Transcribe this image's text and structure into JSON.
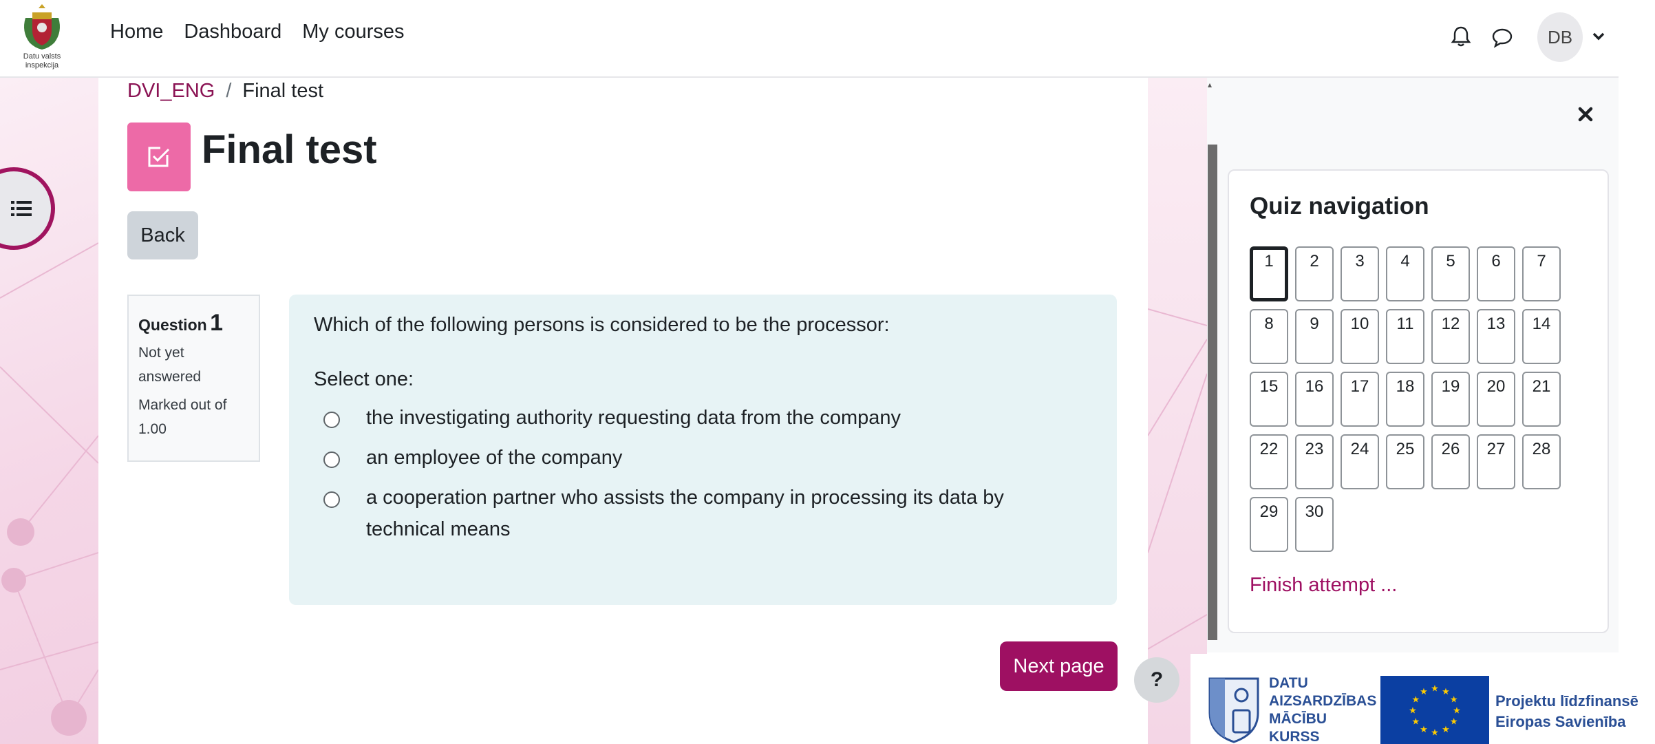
{
  "navbar": {
    "logo_lines": [
      "Datu valsts",
      "inspekcija"
    ],
    "links": [
      "Home",
      "Dashboard",
      "My courses"
    ],
    "user_initials": "DB",
    "icons": {
      "notifications": "bell-icon",
      "messages": "chat-icon",
      "user_menu": "chevron-down-icon"
    }
  },
  "breadcrumb": {
    "course": "DVI_ENG",
    "separator": "/",
    "current": "Final test"
  },
  "page": {
    "title": "Final test",
    "back_label": "Back"
  },
  "question": {
    "label": "Question",
    "number": "1",
    "state": "Not yet answered",
    "grade": "Marked out of 1.00",
    "text": "Which of the following persons is considered to be the processor:",
    "prompt": "Select one:",
    "answers": [
      "the investigating authority requesting data from the company",
      "an employee of the company",
      "a cooperation partner who assists the company in processing its data by technical means"
    ],
    "selected": null
  },
  "actions": {
    "next_label": "Next page",
    "help_label": "?"
  },
  "quiz_navigation": {
    "title": "Quiz navigation",
    "current": 1,
    "questions": [
      "1",
      "2",
      "3",
      "4",
      "5",
      "6",
      "7",
      "8",
      "9",
      "10",
      "11",
      "12",
      "13",
      "14",
      "15",
      "16",
      "17",
      "18",
      "19",
      "20",
      "21",
      "22",
      "23",
      "24",
      "25",
      "26",
      "27",
      "28",
      "29",
      "30"
    ],
    "finish_label": "Finish attempt ..."
  },
  "footer": {
    "course_logo_lines": [
      "DATU",
      "AIZSARDZĪBAS",
      "MĀCĪBU",
      "KURSS"
    ],
    "eu_lines": [
      "Projektu līdzfinansē",
      "Eiropas Savienība"
    ]
  },
  "colors": {
    "accent": "#9e1062",
    "quiz_badge": "#ed6aa7",
    "question_bg": "#e7f3f5",
    "eu_blue": "#0b3fa2",
    "eu_star": "#ffcc00"
  }
}
